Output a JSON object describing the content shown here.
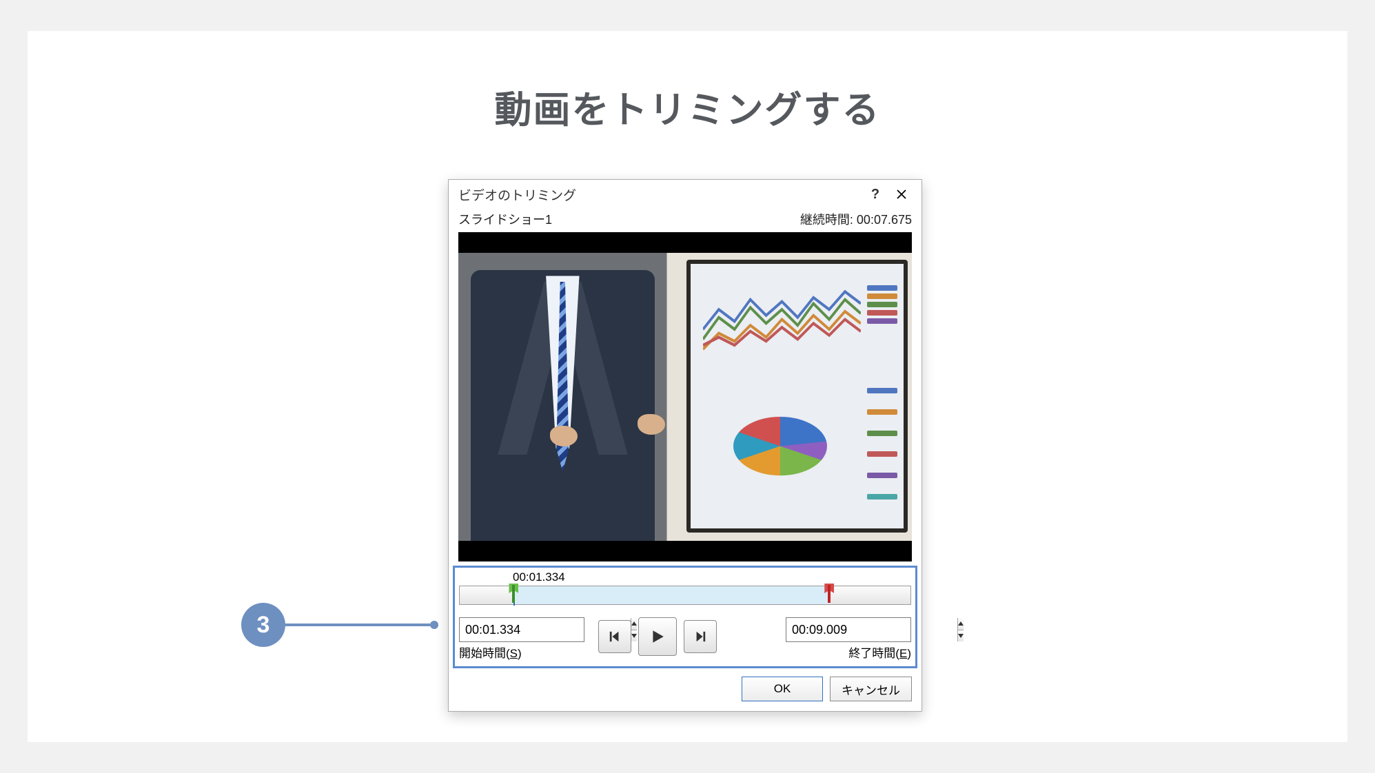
{
  "page": {
    "title": "動画をトリミングする",
    "callout_number": "3"
  },
  "dialog": {
    "title": "ビデオのトリミング",
    "help_tooltip": "?",
    "close_tooltip": "×",
    "media_name": "スライドショー1",
    "duration_label": "継続時間:",
    "duration_value": "00:07.675",
    "playhead_time": "00:01.334",
    "start_time": {
      "value": "00:01.334",
      "label_prefix": "開始時間(",
      "accelerator": "S",
      "label_suffix": ")"
    },
    "end_time": {
      "value": "00:09.009",
      "label_prefix": "終了時間(",
      "accelerator": "E",
      "label_suffix": ")"
    },
    "buttons": {
      "ok": "OK",
      "cancel": "キャンセル"
    }
  }
}
